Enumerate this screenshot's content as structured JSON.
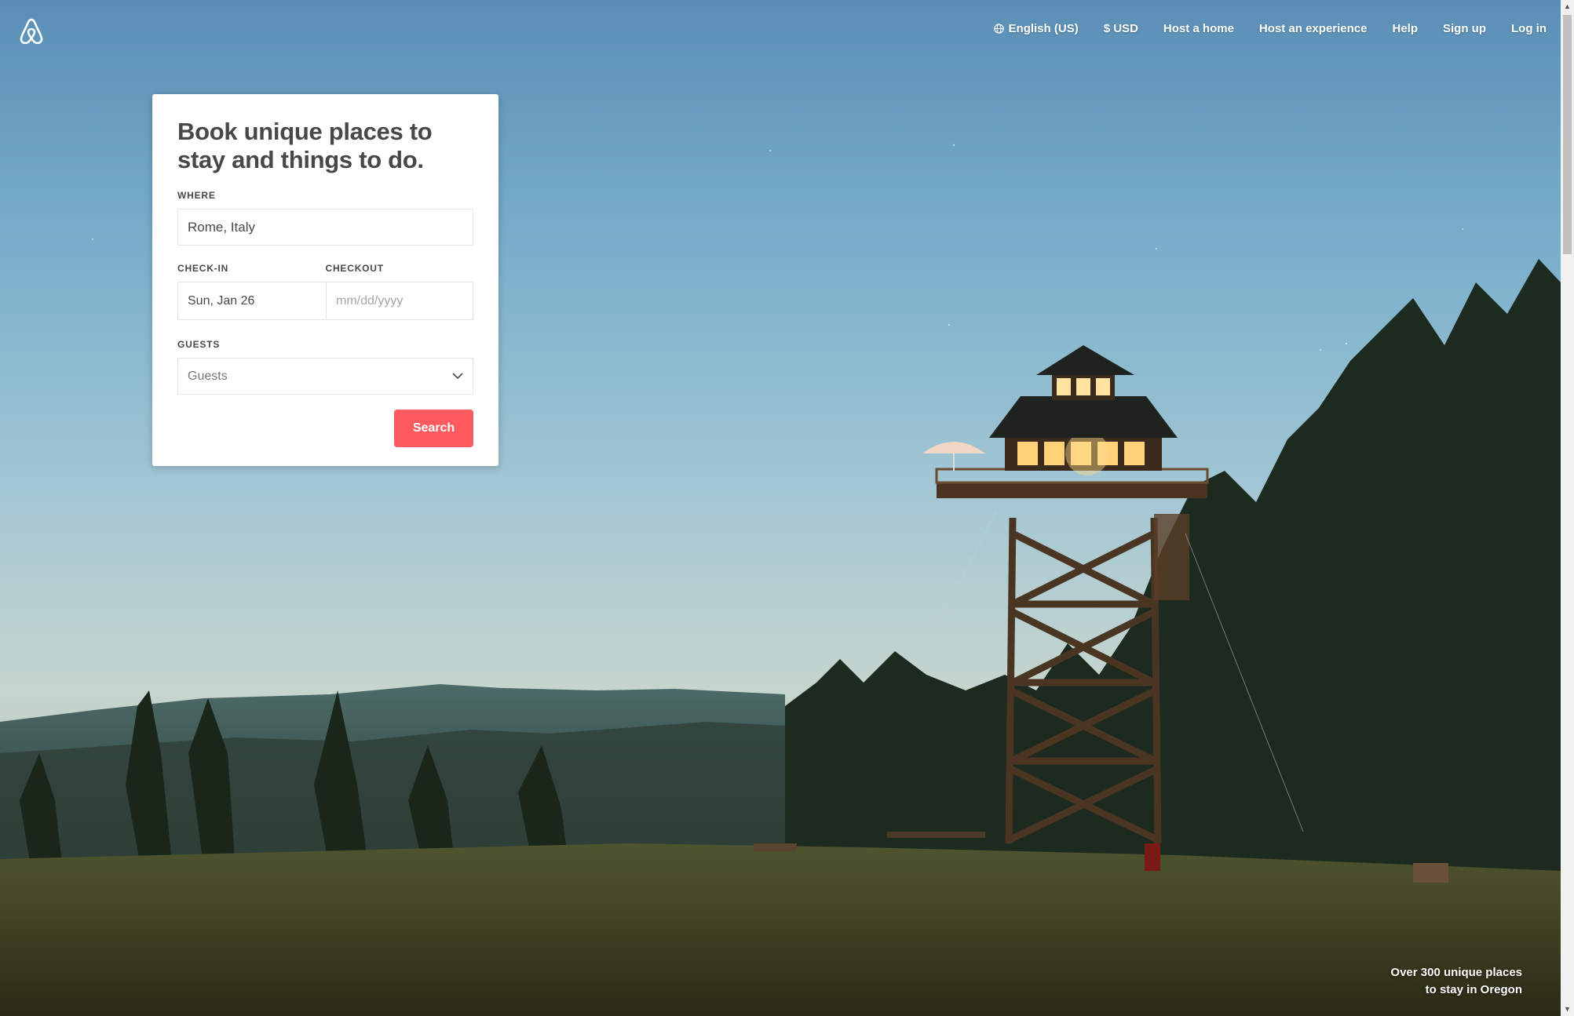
{
  "header": {
    "logo_icon": "airbnb-belo-icon",
    "nav": {
      "language": "English (US)",
      "currency": "$ USD",
      "host_home": "Host a home",
      "host_experience": "Host an experience",
      "help": "Help",
      "signup": "Sign up",
      "login": "Log in"
    }
  },
  "search_card": {
    "heading": "Book unique places to stay and things to do.",
    "where_label": "WHERE",
    "where_value": "Rome, Italy",
    "checkin_label": "CHECK-IN",
    "checkin_value": "Sun, Jan 26",
    "checkout_label": "CHECKOUT",
    "checkout_placeholder": "mm/dd/yyyy",
    "guests_label": "GUESTS",
    "guests_value": "Guests",
    "search_button": "Search"
  },
  "hero_caption": {
    "line1": "Over 300 unique places",
    "line2": "to stay in Oregon"
  },
  "colors": {
    "accent": "#ff5a5f",
    "text": "#484848"
  }
}
